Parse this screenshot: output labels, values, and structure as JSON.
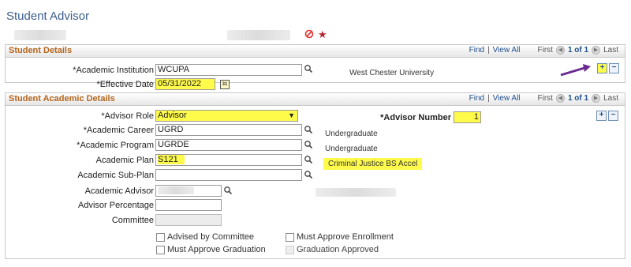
{
  "page": {
    "title": "Student Advisor"
  },
  "student_details": {
    "title": "Student Details",
    "nav": {
      "find": "Find",
      "sep": "|",
      "view_all": "View All",
      "first": "First",
      "count": "1 of 1",
      "last": "Last"
    },
    "institution": {
      "label": "*Academic Institution",
      "value": "WCUPA",
      "description": "West Chester University"
    },
    "effective_date": {
      "label": "*Effective Date",
      "value": "05/31/2022",
      "calendar_icon": "31"
    }
  },
  "academic_details": {
    "title": "Student Academic Details",
    "nav": {
      "find": "Find",
      "sep": "|",
      "view_all": "View All",
      "first": "First",
      "count": "1 of 1",
      "last": "Last"
    },
    "advisor_role": {
      "label": "*Advisor Role",
      "value": "Advisor"
    },
    "advisor_number": {
      "label": "*Advisor Number",
      "value": "1"
    },
    "academic_career": {
      "label": "*Academic Career",
      "value": "UGRD",
      "description": "Undergraduate"
    },
    "academic_program": {
      "label": "*Academic Program",
      "value": "UGRDE",
      "description": "Undergraduate"
    },
    "academic_plan": {
      "label": "Academic Plan",
      "value": "S121",
      "description": "Criminal Justice BS Accel"
    },
    "academic_subplan": {
      "label": "Academic Sub-Plan",
      "value": ""
    },
    "academic_advisor": {
      "label": "Academic Advisor",
      "value": ""
    },
    "advisor_percentage": {
      "label": "Advisor Percentage",
      "value": ""
    },
    "committee": {
      "label": "Committee",
      "value": ""
    },
    "checkboxes": {
      "advised_by_committee": "Advised by Committee",
      "must_approve_enrollment": "Must Approve Enrollment",
      "must_approve_graduation": "Must Approve Graduation",
      "graduation_approved": "Graduation Approved"
    }
  },
  "icons": {
    "add": "+",
    "remove": "−"
  },
  "colors": {
    "highlight": "#fffb4a",
    "section_title": "#b5651d",
    "arrow": "#6a2c91",
    "link": "#1f4e8c"
  }
}
